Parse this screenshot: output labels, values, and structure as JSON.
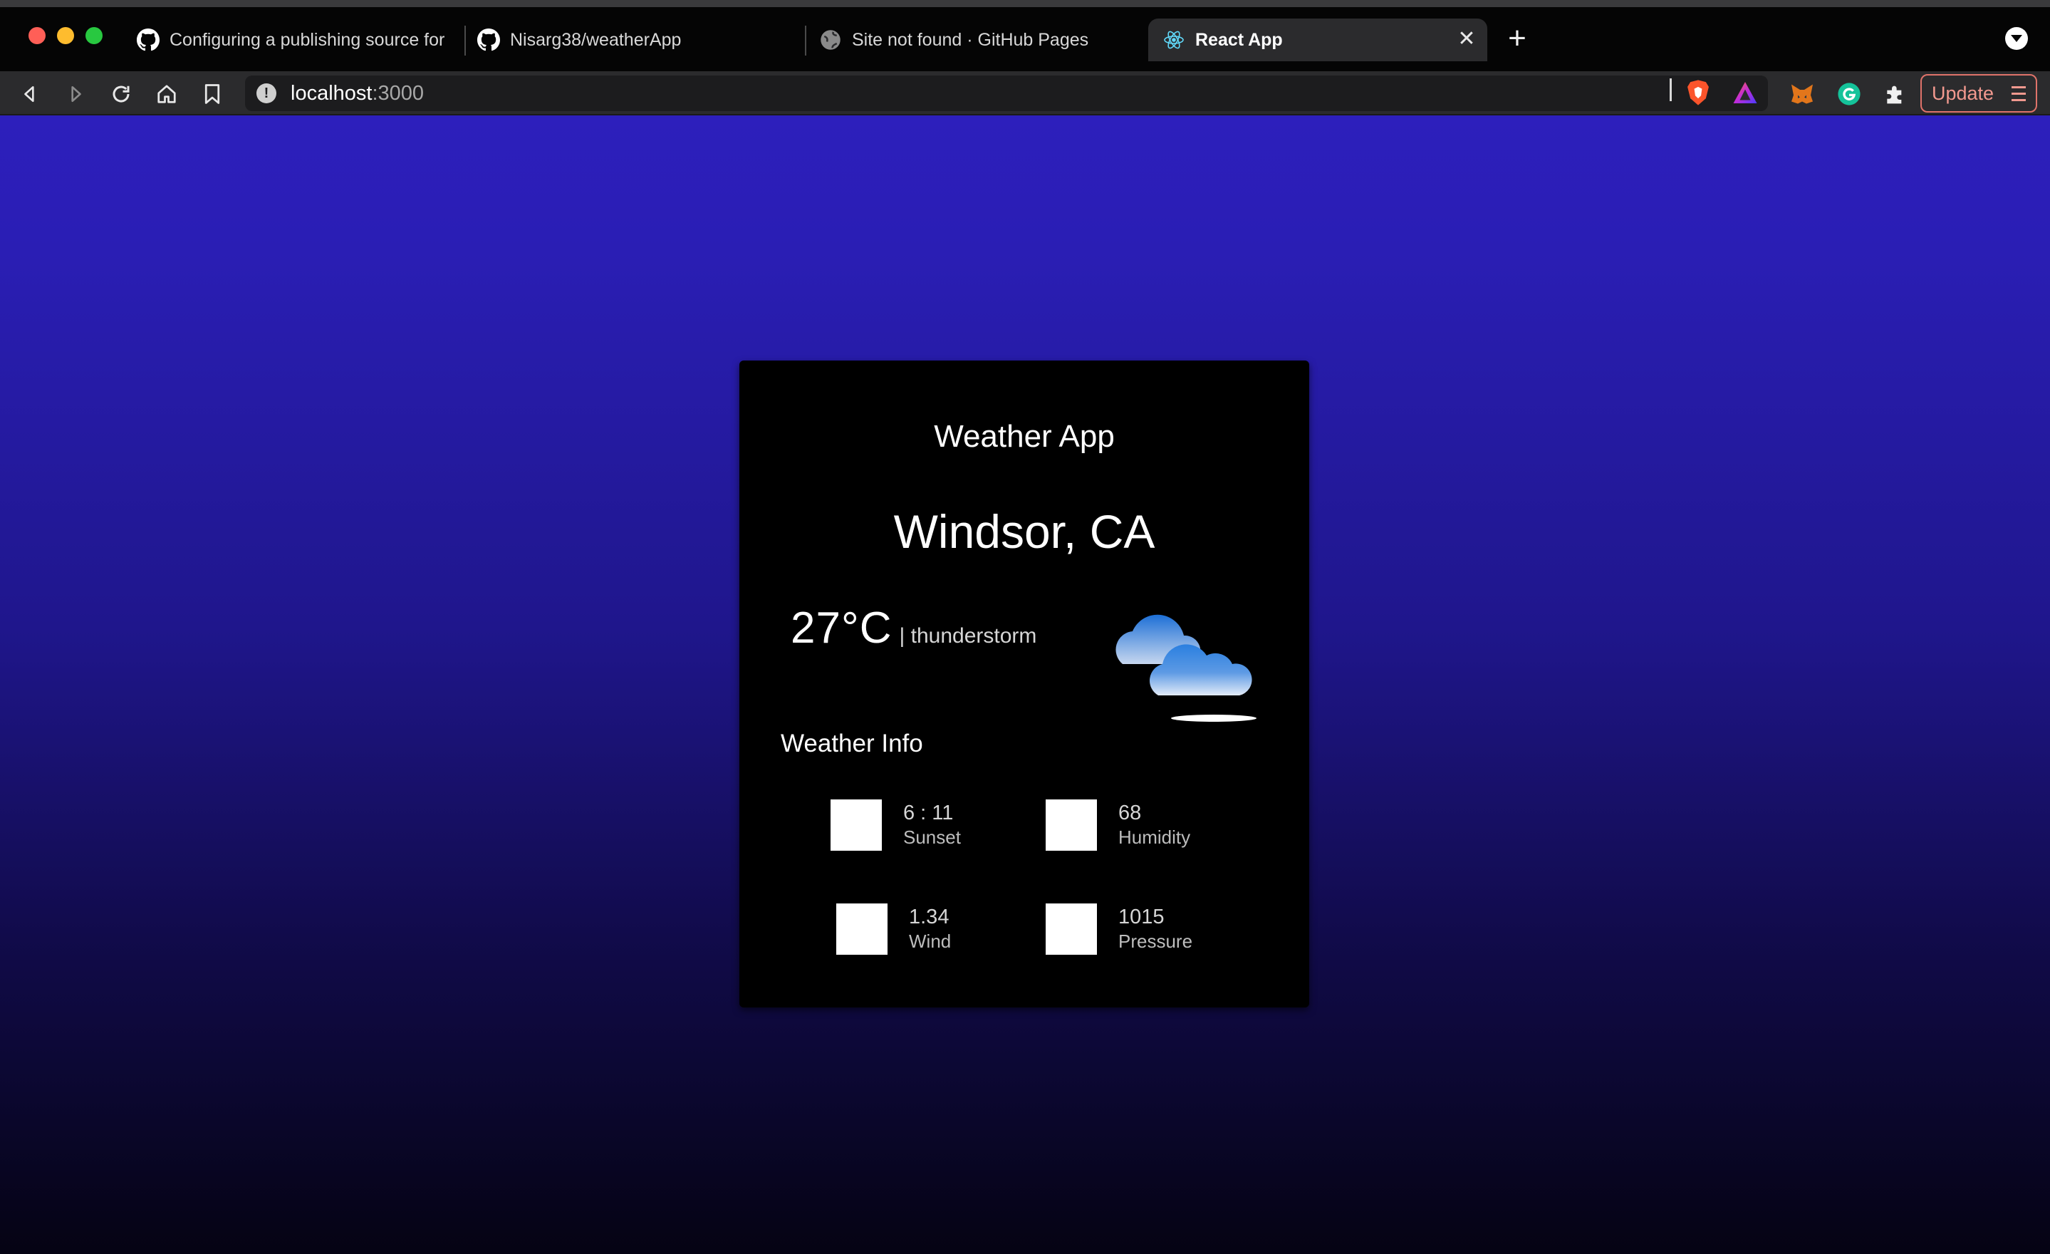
{
  "browser": {
    "tabs": [
      {
        "label": "Configuring a publishing source for",
        "icon": "github-icon",
        "active": false
      },
      {
        "label": "Nisarg38/weatherApp",
        "icon": "github-icon",
        "active": false
      },
      {
        "label": "Site not found · GitHub Pages",
        "icon": "globe-icon",
        "active": false
      },
      {
        "label": "React App",
        "icon": "react-icon",
        "active": true
      }
    ],
    "close_tab_glyph": "✕",
    "new_tab_glyph": "+",
    "url": {
      "host": "localhost",
      "port": ":3000"
    },
    "update_label": "Update",
    "accent_update": "#e0736a"
  },
  "page": {
    "app_title": "Weather App",
    "location": "Windsor, CA",
    "temperature": "27°C",
    "condition": "| thunderstorm",
    "weather_icon": "cloud-icon",
    "info_heading": "Weather Info",
    "info": [
      {
        "value": "6 : 11",
        "label": "Sunset"
      },
      {
        "value": "68",
        "label": "Humidity"
      },
      {
        "value": "1.34",
        "label": "Wind"
      },
      {
        "value": "1015",
        "label": "Pressure"
      }
    ],
    "gradient_top": "#2d1fbc",
    "gradient_bottom": "#050313"
  }
}
